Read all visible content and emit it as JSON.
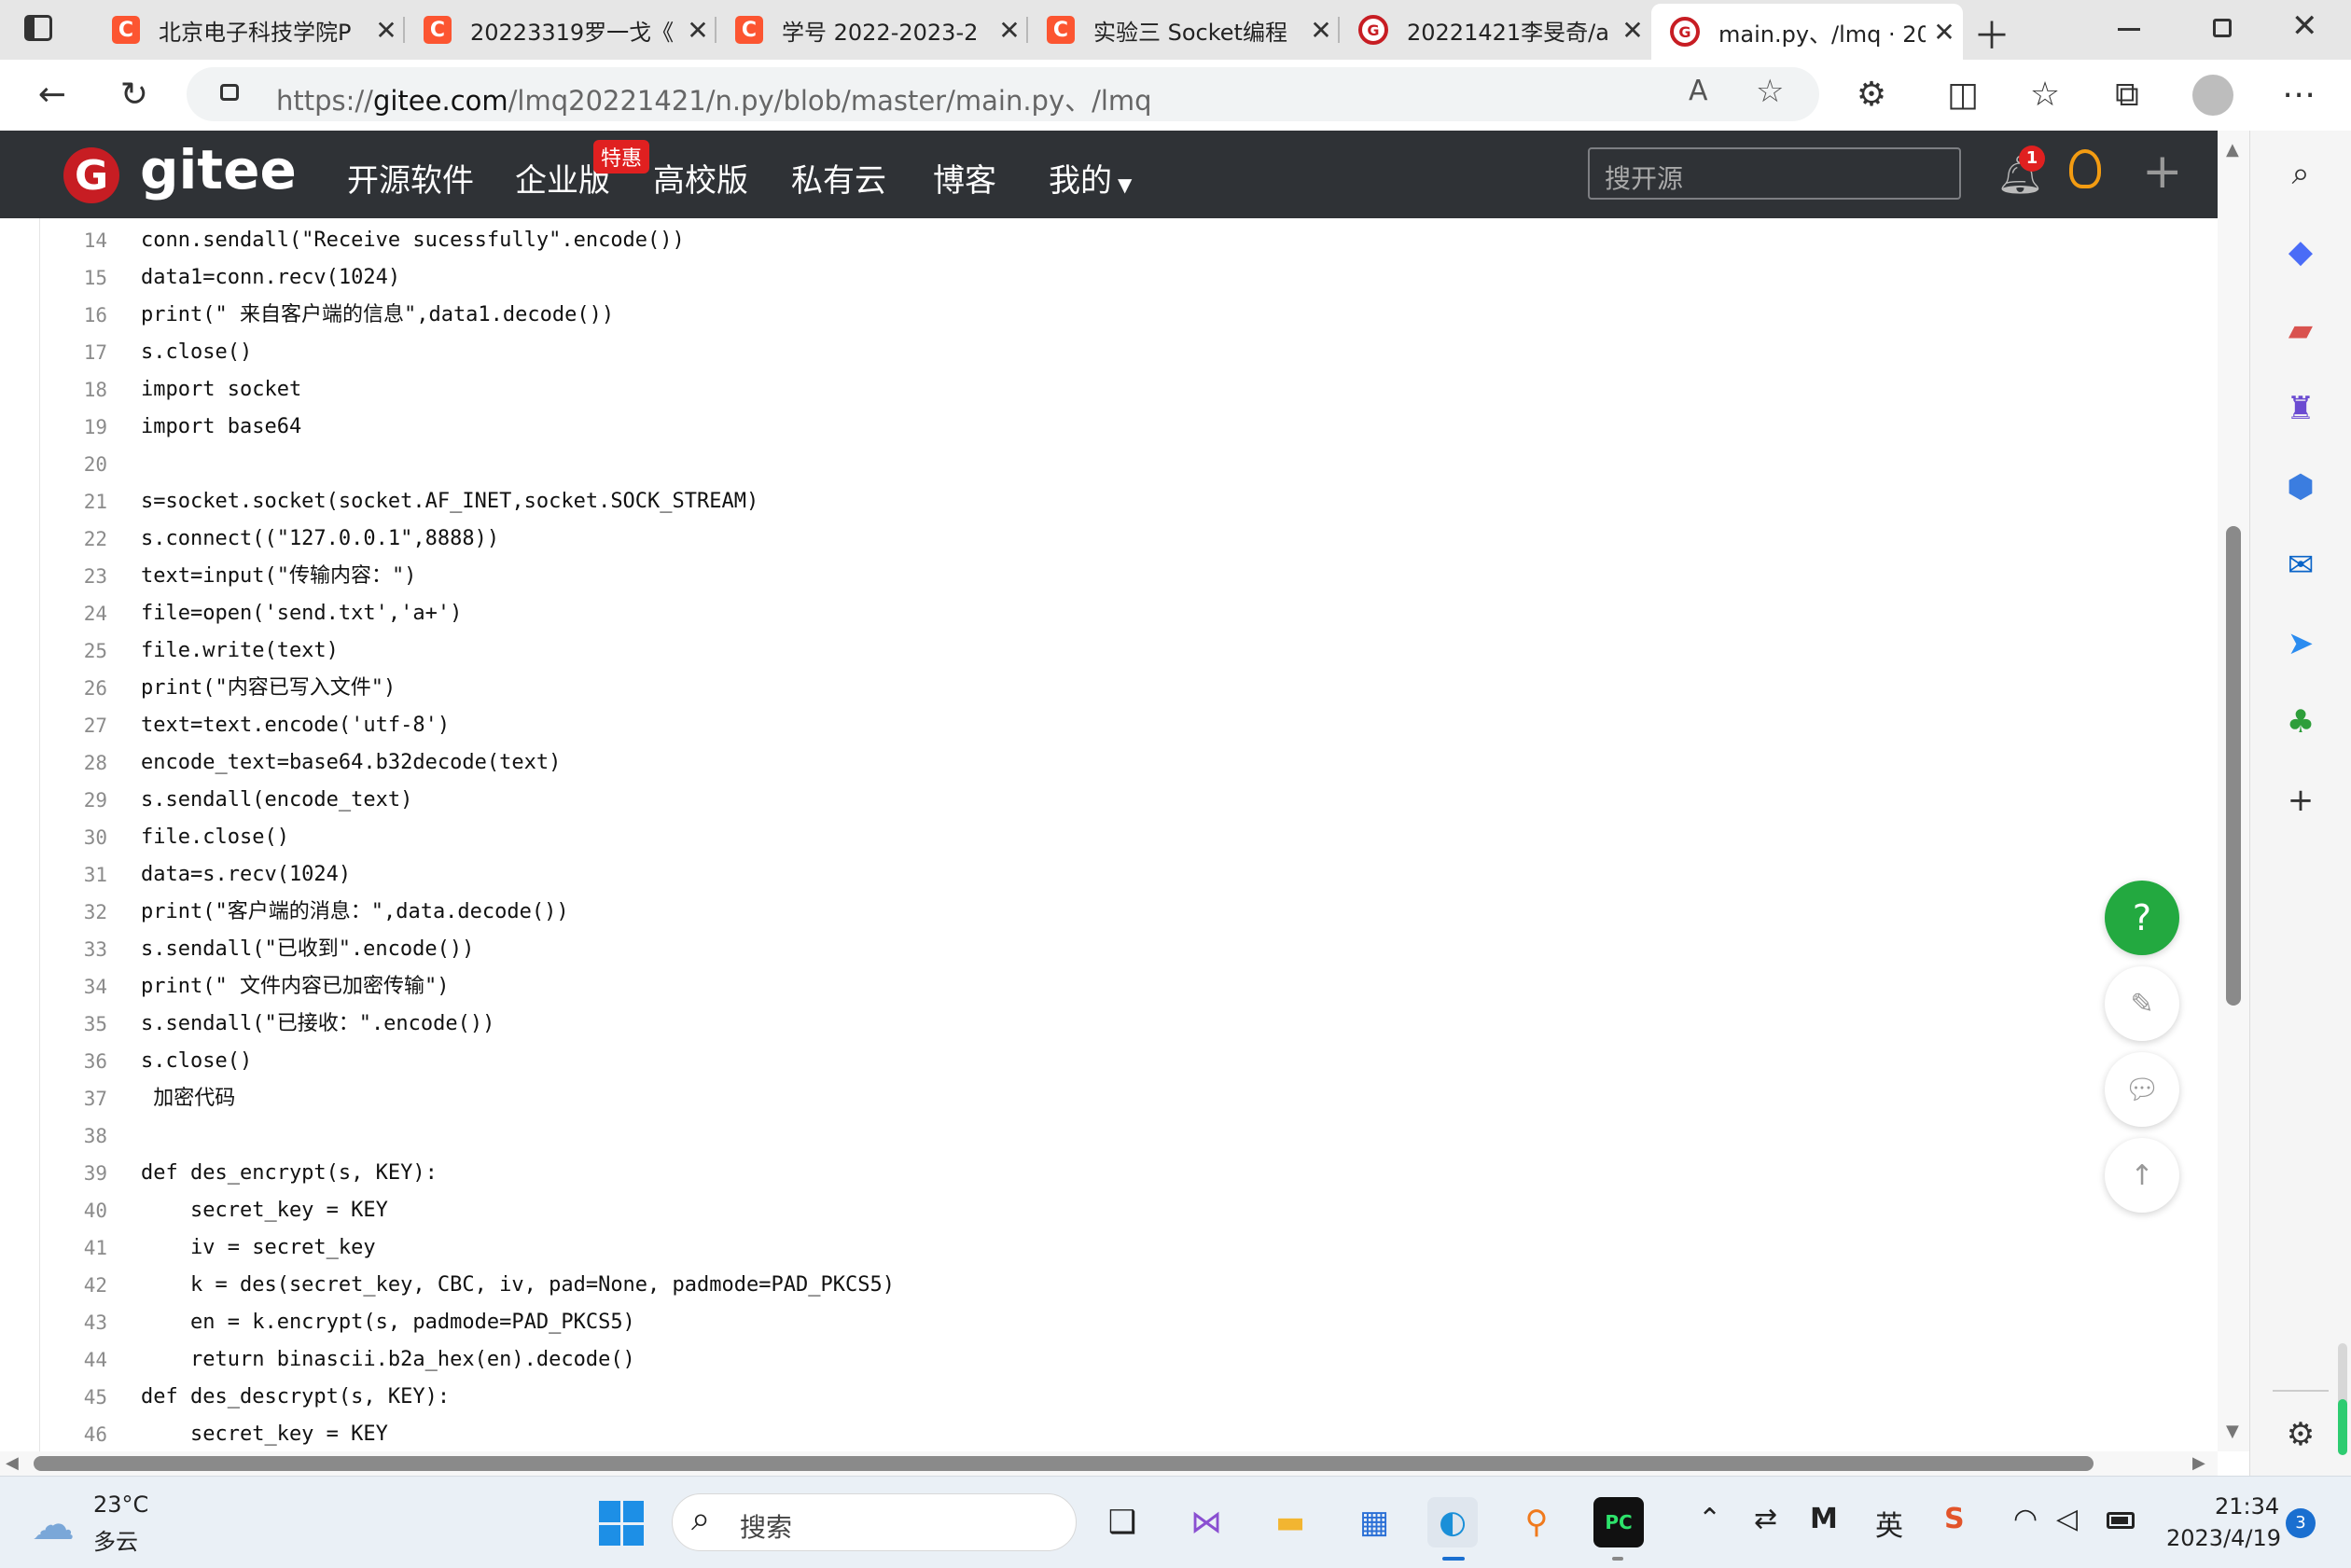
{
  "browser": {
    "tabs": [
      {
        "title": "北京电子科技学院P",
        "icon": "csdn-icon"
      },
      {
        "title": "20223319罗一戈《",
        "icon": "csdn-icon"
      },
      {
        "title": "学号 2022-2023-2",
        "icon": "csdn-icon"
      },
      {
        "title": "实验三 Socket编程",
        "icon": "csdn-icon"
      },
      {
        "title": "20221421李旻奇/a",
        "icon": "gitee-icon"
      },
      {
        "title": "main.py、/lmq · 20",
        "icon": "gitee-icon",
        "active": true
      }
    ],
    "url_prefix": "https://",
    "url_host": "gitee.com",
    "url_path": "/lmq20221421/n.py/blob/master/main.py、/lmq"
  },
  "gitee": {
    "logo_text": "gitee",
    "nav": [
      "开源软件",
      "企业版",
      "高校版",
      "私有云",
      "博客",
      "我的"
    ],
    "promo_badge": "特惠",
    "search_placeholder": "搜开源",
    "notification_count": "1"
  },
  "code": {
    "lines": [
      {
        "n": "14",
        "text": "conn.sendall(\"Receive sucessfully\".encode())"
      },
      {
        "n": "15",
        "text": "data1=conn.recv(1024)"
      },
      {
        "n": "16",
        "text": "print(\" 来自客户端的信息\",data1.decode())"
      },
      {
        "n": "17",
        "text": "s.close()"
      },
      {
        "n": "18",
        "text": "import socket"
      },
      {
        "n": "19",
        "text": "import base64"
      },
      {
        "n": "20",
        "text": ""
      },
      {
        "n": "21",
        "text": "s=socket.socket(socket.AF_INET,socket.SOCK_STREAM)"
      },
      {
        "n": "22",
        "text": "s.connect((\"127.0.0.1\",8888))"
      },
      {
        "n": "23",
        "text": "text=input(\"传输内容：\")"
      },
      {
        "n": "24",
        "text": "file=open('send.txt','a+')"
      },
      {
        "n": "25",
        "text": "file.write(text)"
      },
      {
        "n": "26",
        "text": "print(\"内容已写入文件\")"
      },
      {
        "n": "27",
        "text": "text=text.encode('utf-8')"
      },
      {
        "n": "28",
        "text": "encode_text=base64.b32decode(text)"
      },
      {
        "n": "29",
        "text": "s.sendall(encode_text)"
      },
      {
        "n": "30",
        "text": "file.close()"
      },
      {
        "n": "31",
        "text": "data=s.recv(1024)"
      },
      {
        "n": "32",
        "text": "print(\"客户端的消息：\",data.decode())"
      },
      {
        "n": "33",
        "text": "s.sendall(\"已收到\".encode())"
      },
      {
        "n": "34",
        "text": "print(\" 文件内容已加密传输\")"
      },
      {
        "n": "35",
        "text": "s.sendall(\"已接收：\".encode())"
      },
      {
        "n": "36",
        "text": "s.close()"
      },
      {
        "n": "37",
        "text": " 加密代码"
      },
      {
        "n": "38",
        "text": ""
      },
      {
        "n": "39",
        "text": "def des_encrypt(s, KEY):"
      },
      {
        "n": "40",
        "text": "    secret_key = KEY"
      },
      {
        "n": "41",
        "text": "    iv = secret_key"
      },
      {
        "n": "42",
        "text": "    k = des(secret_key, CBC, iv, pad=None, padmode=PAD_PKCS5)"
      },
      {
        "n": "43",
        "text": "    en = k.encrypt(s, padmode=PAD_PKCS5)"
      },
      {
        "n": "44",
        "text": "    return binascii.b2a_hex(en).decode()"
      },
      {
        "n": "45",
        "text": "def des_descrypt(s, KEY):"
      },
      {
        "n": "46",
        "text": "    secret_key = KEY"
      }
    ]
  },
  "floating": {
    "help_label": "?"
  },
  "taskbar": {
    "weather_temp": "23°C",
    "weather_desc": "多云",
    "search_label": "搜索",
    "ime_label": "英",
    "time": "21:34",
    "date": "2023/4/19",
    "notification_count": "3"
  }
}
